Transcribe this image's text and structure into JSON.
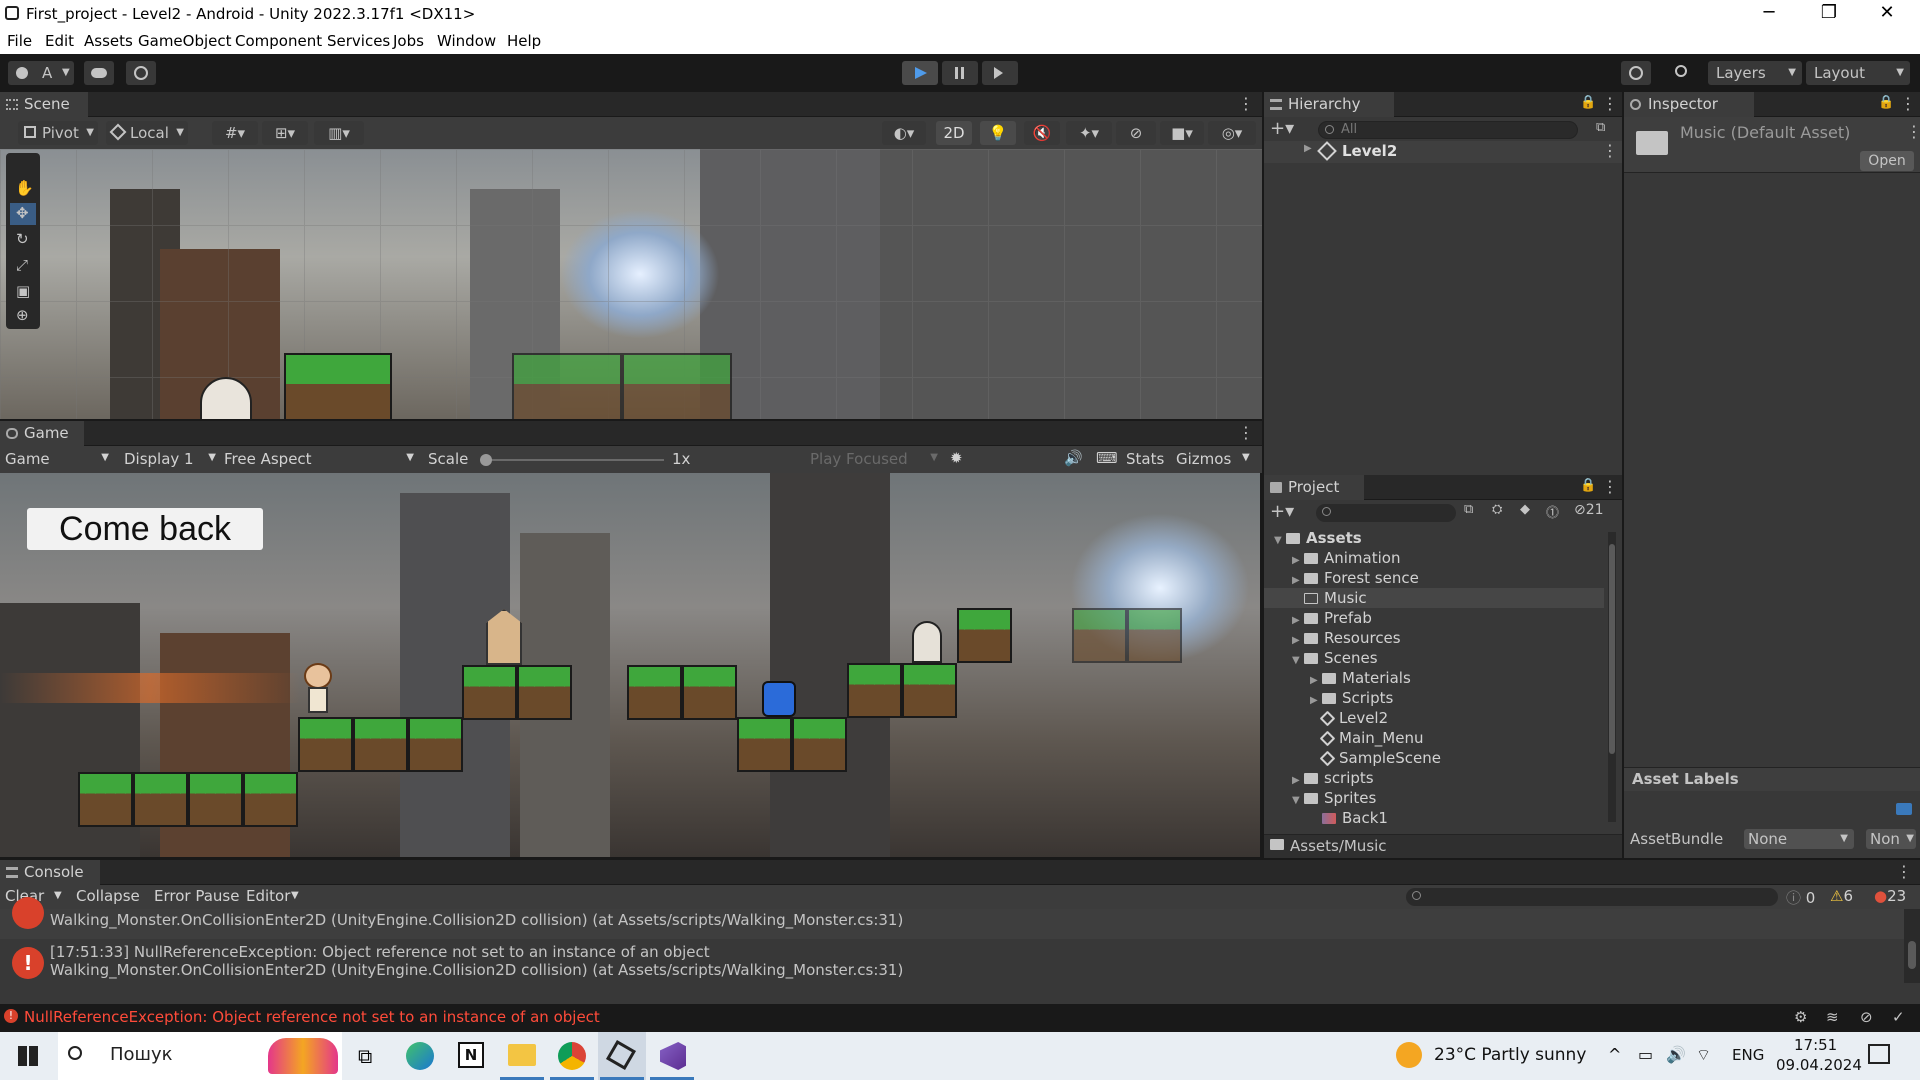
{
  "window": {
    "title": "First_project - Level2 - Android - Unity 2022.3.17f1 <DX11>",
    "minimize": "─",
    "maximize": "❐",
    "close": "✕"
  },
  "menu": [
    "File",
    "Edit",
    "Assets",
    "GameObject",
    "Component",
    "Services",
    "Jobs",
    "Window",
    "Help"
  ],
  "toolbar": {
    "account": "A",
    "layers": "Layers",
    "layout": "Layout"
  },
  "scene": {
    "tab": "Scene",
    "pivot": "Pivot",
    "local": "Local",
    "mode2d": "2D"
  },
  "game": {
    "tab": "Game",
    "mode": "Game",
    "display": "Display 1",
    "aspect": "Free Aspect",
    "scale_label": "Scale",
    "scale_value": "1x",
    "play_focused": "Play Focused",
    "stats": "Stats",
    "gizmos": "Gizmos",
    "button": "Come back"
  },
  "hierarchy": {
    "tab": "Hierarchy",
    "search_placeholder": "All",
    "root": "Level2"
  },
  "inspector": {
    "tab": "Inspector",
    "asset_title": "Music (Default Asset)",
    "open": "Open",
    "asset_labels": "Asset Labels",
    "assetbundle_label": "AssetBundle",
    "assetbundle_value": "None",
    "assetbundle_variant": "Non"
  },
  "project": {
    "tab": "Project",
    "hidden_count": "21",
    "path": "Assets/Music",
    "tree": [
      {
        "label": "Assets",
        "depth": 0,
        "kind": "folder",
        "open": true
      },
      {
        "label": "Animation",
        "depth": 1,
        "kind": "folder"
      },
      {
        "label": "Forest sence",
        "depth": 1,
        "kind": "folder"
      },
      {
        "label": "Music",
        "depth": 1,
        "kind": "folder",
        "selected": true
      },
      {
        "label": "Prefab",
        "depth": 1,
        "kind": "folder"
      },
      {
        "label": "Resources",
        "depth": 1,
        "kind": "folder"
      },
      {
        "label": "Scenes",
        "depth": 1,
        "kind": "folder",
        "open": true
      },
      {
        "label": "Materials",
        "depth": 2,
        "kind": "folder"
      },
      {
        "label": "Scripts",
        "depth": 2,
        "kind": "folder"
      },
      {
        "label": "Level2",
        "depth": 2,
        "kind": "scene"
      },
      {
        "label": "Main_Menu",
        "depth": 2,
        "kind": "scene"
      },
      {
        "label": "SampleScene",
        "depth": 2,
        "kind": "scene"
      },
      {
        "label": "scripts",
        "depth": 1,
        "kind": "folder"
      },
      {
        "label": "Sprites",
        "depth": 1,
        "kind": "folder",
        "open": true
      },
      {
        "label": "Back1",
        "depth": 2,
        "kind": "sprite"
      }
    ]
  },
  "console": {
    "tab": "Console",
    "clear": "Clear",
    "collapse": "Collapse",
    "error_pause": "Error Pause",
    "editor": "Editor",
    "info_count": "0",
    "warn_count": "6",
    "error_count": "23",
    "rows": [
      {
        "line1": "Walking_Monster.OnCollisionEnter2D (UnityEngine.Collision2D collision) (at Assets/scripts/Walking_Monster.cs:31)",
        "line2": ""
      },
      {
        "line1": "[17:51:33] NullReferenceException: Object reference not set to an instance of an object",
        "line2": "Walking_Monster.OnCollisionEnter2D (UnityEngine.Collision2D collision) (at Assets/scripts/Walking_Monster.cs:31)"
      }
    ],
    "status": "NullReferenceException: Object reference not set to an instance of an object"
  },
  "taskbar": {
    "search": "Пошук",
    "weather": "23°C  Partly sunny",
    "lang": "ENG",
    "time": "17:51",
    "date": "09.04.2024"
  },
  "colors": {
    "error": "#d9412b",
    "status_error": "#ff4b3a",
    "accent": "#3a79bb"
  }
}
